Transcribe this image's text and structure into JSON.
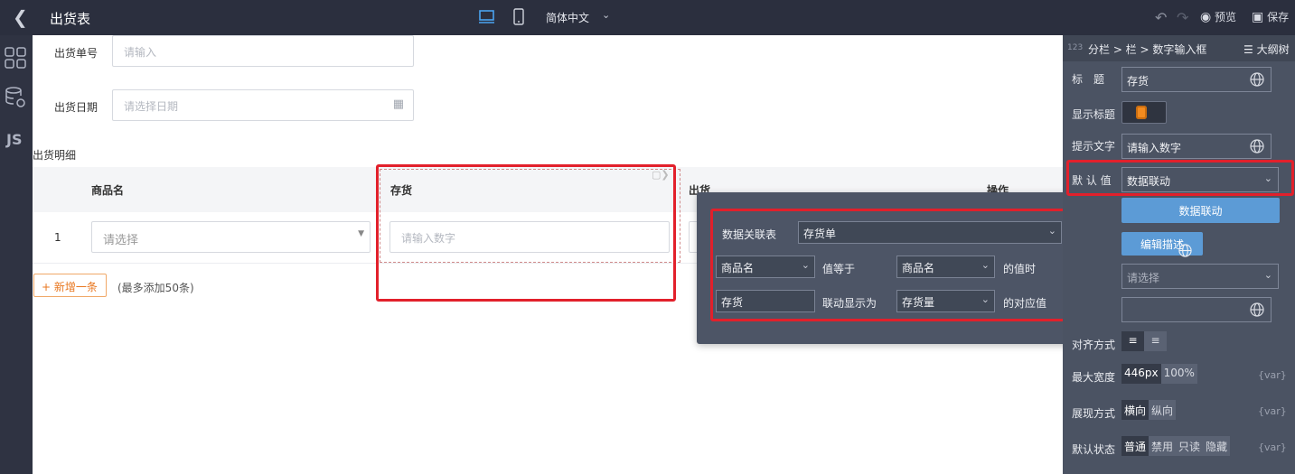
{
  "topbar": {
    "title": "出货表",
    "language": "简体中文",
    "preview": "预览",
    "save": "保存"
  },
  "form": {
    "order_no_label": "出货单号",
    "order_no_placeholder": "请输入",
    "date_label": "出货日期",
    "date_placeholder": "请选择日期",
    "detail_title": "出货明细"
  },
  "table": {
    "headers": [
      "商品名",
      "存货",
      "出货",
      "操作"
    ],
    "rows": [
      {
        "index": "1",
        "product_placeholder": "请选择",
        "stock_placeholder": "请输入数字"
      }
    ],
    "add_label": "新增一条",
    "add_hint": "(最多添加50条)"
  },
  "popup": {
    "source_label": "数据关联表",
    "source_value": "存货单",
    "field_left": "商品名",
    "equals_label": "值等于",
    "field_right": "商品名",
    "when_label": "的值时",
    "target_field": "存货",
    "display_label": "联动显示为",
    "display_value": "存货量",
    "corresponding_label": "的对应值"
  },
  "panel": {
    "breadcrumb_num": "123",
    "breadcrumb": "分栏 > 栏 > 数字输入框",
    "outline": "大纲树",
    "title_label": "标　题",
    "title_value": "存货",
    "show_title_label": "显示标题",
    "hint_label": "提示文字",
    "hint_value": "请输入数字",
    "default_label": "默 认 值",
    "default_value": "数据联动",
    "linkage_button": "数据联动",
    "edit_desc": "编辑描述",
    "select_placeholder": "请选择",
    "align_label": "对齐方式",
    "max_width_label": "最大宽度",
    "max_width_px": "446px",
    "max_width_pct": "100%",
    "display_label": "展现方式",
    "display_options": [
      "横向",
      "纵向"
    ],
    "state_label": "默认状态",
    "state_options": [
      "普通",
      "禁用",
      "只读",
      "隐藏"
    ],
    "var_tag": "{var}"
  },
  "colors": {
    "topbar": "#2b2f3e",
    "panel": "#4b5363",
    "popup": "#4d5566",
    "highlight": "#e2202b",
    "accent_blue": "#5c9bd6",
    "accent_orange": "#e8761e"
  }
}
